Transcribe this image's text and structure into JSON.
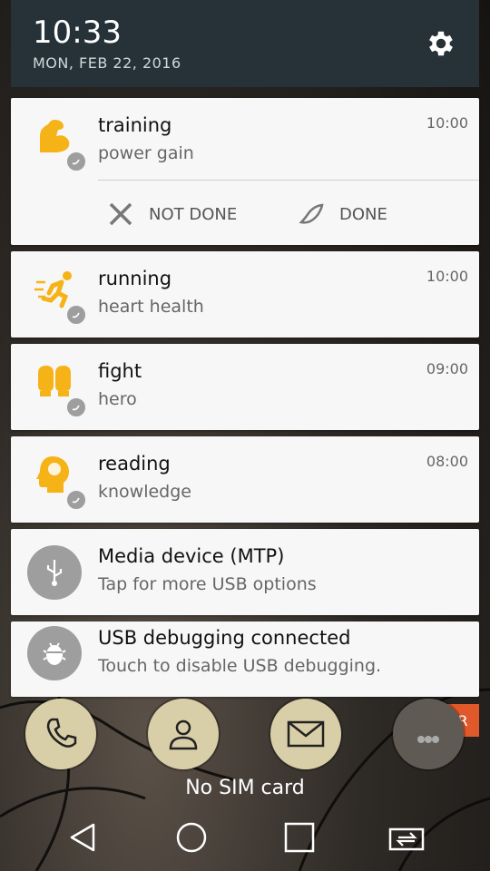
{
  "status": {
    "time": "10:33",
    "date": "MON, FEB 22, 2016"
  },
  "notifications": [
    {
      "title": "training",
      "subtitle": "power gain",
      "time": "10:00",
      "icon": "muscle-arm-icon",
      "actions": [
        {
          "label": "NOT DONE",
          "icon": "close-x-icon"
        },
        {
          "label": "DONE",
          "icon": "done-icon"
        }
      ]
    },
    {
      "title": "running",
      "subtitle": "heart health",
      "time": "10:00",
      "icon": "runner-icon"
    },
    {
      "title": "fight",
      "subtitle": "hero",
      "time": "09:00",
      "icon": "boxing-gloves-icon"
    },
    {
      "title": "reading",
      "subtitle": "knowledge",
      "time": "08:00",
      "icon": "brain-head-icon"
    }
  ],
  "system": [
    {
      "title": "Media device (MTP)",
      "subtitle": "Tap for more USB options",
      "icon": "usb-icon"
    },
    {
      "title": "USB debugging connected",
      "subtitle": "Touch to disable USB debugging.",
      "icon": "android-bug-icon"
    }
  ],
  "clear_label": "CLEAR",
  "lock": {
    "carrier_text": "No SIM card"
  },
  "dock": [
    "phone-icon",
    "contacts-icon",
    "mail-icon",
    "apps-icon"
  ],
  "nav": [
    "back-icon",
    "home-icon",
    "recents-icon",
    "screen-cast-icon"
  ],
  "colors": {
    "accent": "#f5b318",
    "header": "#263238",
    "card": "#f7f7f7",
    "clear": "#e0592a"
  }
}
